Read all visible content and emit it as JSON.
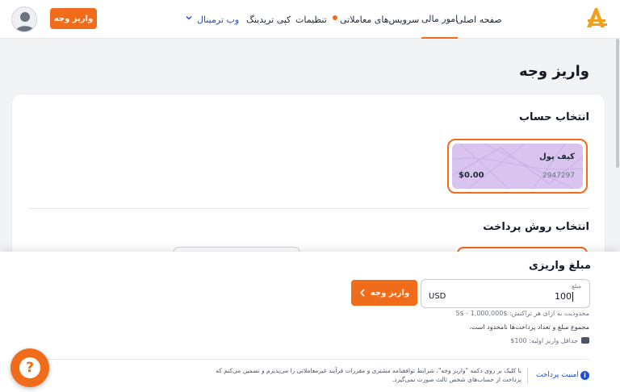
{
  "header": {
    "deposit_button": "واریز وجه",
    "nav": {
      "home": "صفحه اصلی",
      "financial": "امور مالی",
      "trading_services": "سرویس‌های معاملاتی",
      "settings": "تنظیمات",
      "copy_trading": "کپی تریدینگ",
      "web_terminal": "وب ترمینال"
    },
    "logo_letter": "A"
  },
  "page": {
    "title": "واریز وجه",
    "account_section_title": "انتخاب حساب",
    "wallet": {
      "name": "کیف پول",
      "number": "2947297",
      "balance": "$0.00"
    },
    "payment_section_title": "انتخاب روش پرداخت"
  },
  "amount": {
    "title": "مبلغ واریزی",
    "field_label": "مبلغ",
    "value": "100",
    "unit": "USD",
    "submit_label": "واریز وجه",
    "limit_text": "محدودیت به ازای هر تراکنش: $1,000,000 - $5",
    "unlimited_text": "مجموع مبلغ و تعداد پرداخت‌ها نامحدود است.",
    "min_first_deposit": "حداقل واریز اولیه: 100$"
  },
  "footer": {
    "security_link": "امنیت پرداخت",
    "terms": "با کلیک بر روی دکمه \"واریز وجه\"، شرایط توافقنامه مشتری و مقررات فرآیند غیرمعاملاتی را می‌پذیرم و تضمین می‌کنم که پرداخت از حساب‌های شخص ثالث صورت نمی‌گیرد."
  },
  "colors": {
    "accent": "#f06b1a",
    "wallet_card": "#d8c4ee",
    "link": "#1d4ed8"
  },
  "icons": [
    "avatar-icon",
    "chevron-down-icon",
    "logo-icon",
    "chevron-left-icon",
    "info-icon",
    "wallet-icon",
    "help-icon"
  ]
}
